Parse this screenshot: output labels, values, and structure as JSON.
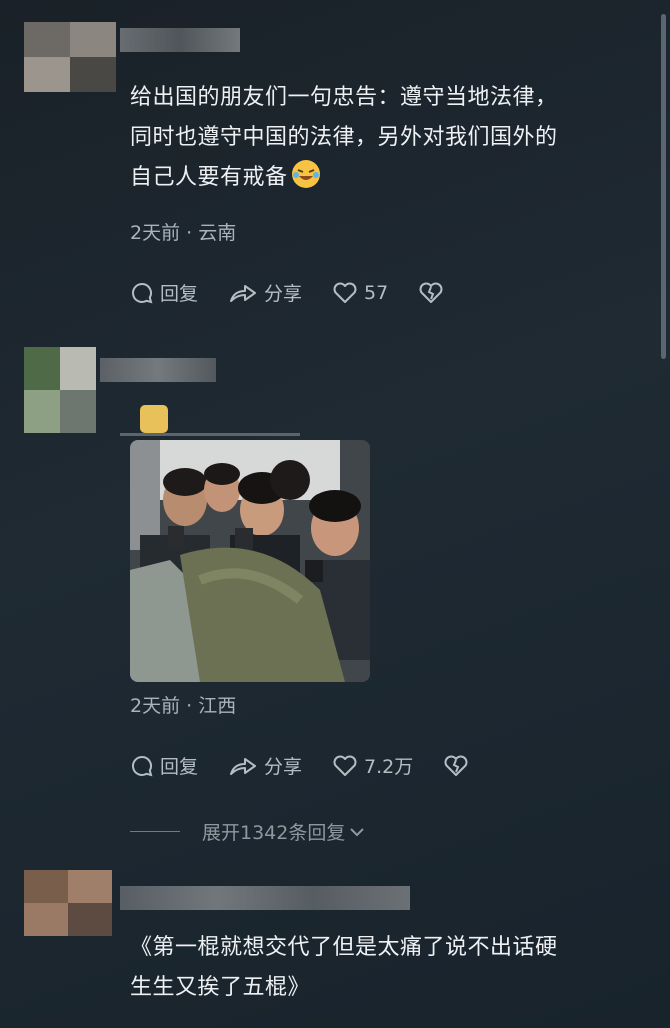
{
  "comments": [
    {
      "text_line1": "给出国的朋友们一句忠告：遵守当地法律，",
      "text_line2": "同时也遵守中国的法律，另外对我们国外的",
      "text_line3": "自己人要有戒备",
      "emoji_icon": "laughing-crying-emoji",
      "meta": "2天前 · 云南",
      "reply_label": "回复",
      "share_label": "分享",
      "like_count": "57"
    },
    {
      "meta": "2天前 · 江西",
      "reply_label": "回复",
      "share_label": "分享",
      "like_count": "7.2万",
      "expand_label": "展开1342条回复"
    },
    {
      "text_line1": "《第一棍就想交代了但是太痛了说不出话硬",
      "text_line2": "生生又挨了五棍》"
    }
  ],
  "colors": {
    "background": "#1f2a33",
    "text": "#eef1f4",
    "meta": "#aab3bb"
  }
}
